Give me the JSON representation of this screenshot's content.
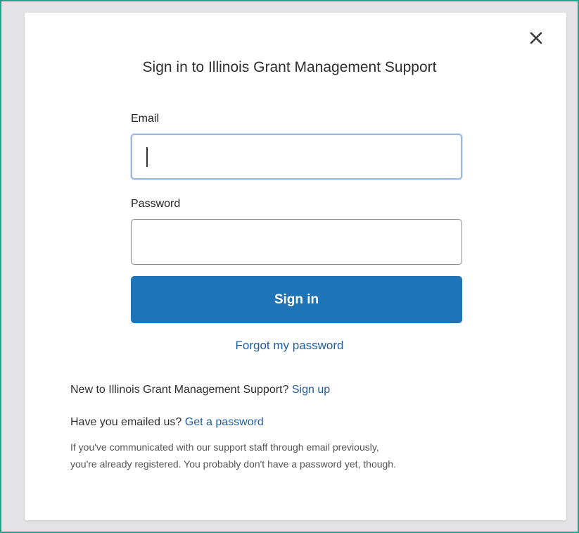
{
  "dialog": {
    "title": "Sign in to Illinois Grant Management Support",
    "close_icon": "close-icon"
  },
  "form": {
    "email_label": "Email",
    "email_value": "",
    "password_label": "Password",
    "password_value": "",
    "signin_label": "Sign in",
    "forgot_label": "Forgot my password"
  },
  "footer": {
    "new_text": "New to Illinois Grant Management Support?",
    "signup_label": "Sign up",
    "emailed_text": "Have you emailed us?",
    "get_password_label": "Get a password",
    "info_line1": "If you've communicated with our support staff through email previously,",
    "info_line2": "you're already registered. You probably don't have a password yet, though."
  },
  "colors": {
    "frame_border": "#17a88b",
    "primary": "#1f73b7",
    "link": "#1f5ea0"
  }
}
